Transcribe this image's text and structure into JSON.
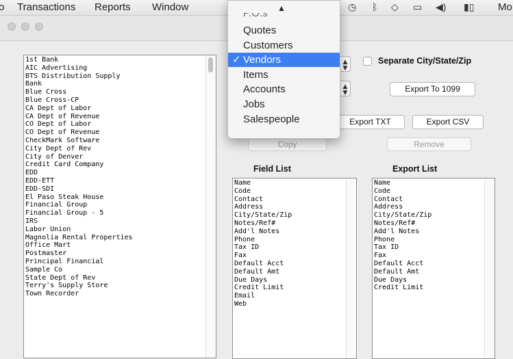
{
  "menubar": {
    "items": [
      "o",
      "Transactions",
      "Reports",
      "Window"
    ],
    "status": {
      "clock_icon": "clock-icon",
      "bluetooth_icon": "bluetooth-icon",
      "wifi_icon": "wifi-icon",
      "airplay_icon": "airplay-icon",
      "volume_icon": "volume-icon",
      "battery_icon": "battery-icon",
      "trailing_text": "Mo"
    }
  },
  "dropdown": {
    "partial_top_item": "P.O.s",
    "items": [
      {
        "label": "Quotes",
        "selected": false
      },
      {
        "label": "Customers",
        "selected": false
      },
      {
        "label": "Vendors",
        "selected": true
      },
      {
        "label": "Items",
        "selected": false
      },
      {
        "label": "Accounts",
        "selected": false
      },
      {
        "label": "Jobs",
        "selected": false
      },
      {
        "label": "Salespeople",
        "selected": false
      }
    ],
    "check_glyph": "✓"
  },
  "vendors": [
    "1st Bank",
    "AIC Advertising",
    "BTS Distribution Supply",
    "Bank",
    "Blue Cross",
    "Blue Cross-CP",
    "CA Dept of Labor",
    "CA Dept of Revenue",
    "CO Dept of Labor",
    "CO Dept of Revenue",
    "CheckMark Software",
    "City Dept of Rev",
    "City of Denver",
    "Credit Card Company",
    "EDD",
    "EDD-ETT",
    "EDD-SDI",
    "El Paso Steak House",
    "Financial Group",
    "Financial Group - 5",
    "IRS",
    "Labor Union",
    "Magnolia Rental Properties",
    "Office Mart",
    "Postmaster",
    "Principal Financial",
    "Sample Co",
    "State Dept of Rev",
    "Terry's Supply Store",
    "Town Recorder"
  ],
  "options": {
    "separate_csz_label": "Separate City/State/Zip",
    "separate_csz_checked": false
  },
  "buttons": {
    "export_1099": "Export To 1099",
    "export_txt": "Export TXT",
    "export_csv": "Export CSV",
    "copy": "Copy",
    "remove": "Remove"
  },
  "field_list": {
    "title": "Field List",
    "items": [
      "Name",
      "Code",
      "Contact",
      "Address",
      "City/State/Zip",
      "Notes/Ref#",
      "Add'l Notes",
      "Phone",
      "Tax ID",
      "Fax",
      "Default Acct",
      "Default Amt",
      "Due Days",
      "Credit Limit",
      "Email",
      "Web"
    ]
  },
  "export_list": {
    "title": "Export List",
    "items": [
      "Name",
      "Code",
      "Contact",
      "Address",
      "City/State/Zip",
      "Notes/Ref#",
      "Add'l Notes",
      "Phone",
      "Tax ID",
      "Fax",
      "Default Acct",
      "Default Amt",
      "Due Days",
      "Credit Limit"
    ]
  }
}
